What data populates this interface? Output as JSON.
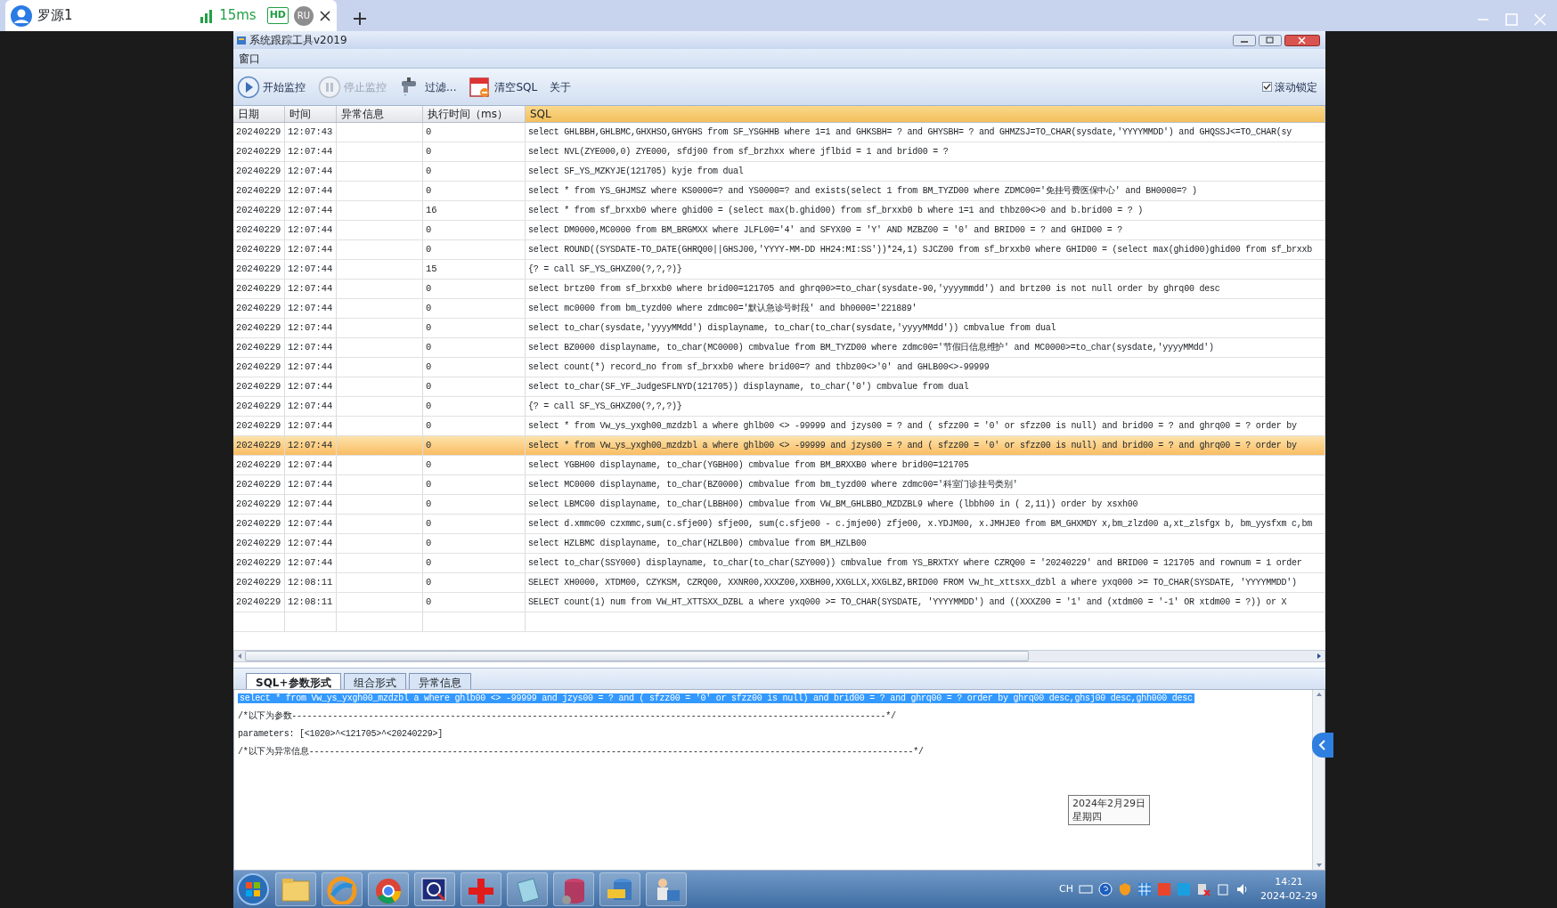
{
  "remote_tab": {
    "title": "罗源1",
    "latency": "15ms",
    "badge": "HD",
    "user_initials": "RU"
  },
  "app": {
    "title": "系统跟踪工具v2019",
    "menu": [
      "窗口"
    ]
  },
  "toolbar": [
    {
      "kind": "play",
      "label": "开始监控",
      "disabled": false
    },
    {
      "kind": "pause",
      "label": "停止监控",
      "disabled": true
    },
    {
      "kind": "filter",
      "label": "过滤...",
      "disabled": false
    },
    {
      "kind": "clear",
      "label": "清空SQL",
      "disabled": false
    },
    {
      "kind": "text",
      "label": "关于",
      "disabled": false
    }
  ],
  "scroll_lock": {
    "label": "滚动锁定",
    "checked": true
  },
  "table": {
    "columns": [
      "日期",
      "时间",
      "异常信息",
      "执行时间（ms）",
      "SQL"
    ],
    "rows": [
      {
        "date": "20240229",
        "time": "12:07:43",
        "error": "",
        "duration": "0",
        "sql": "select GHLBBH,GHLBMC,GHXHSO,GHYGHS from SF_YSGHHB where 1=1 and GHKSBH= ? and GHYSBH= ? and GHMZSJ=TO_CHAR(sysdate,'YYYYMMDD') and GHQSSJ<=TO_CHAR(sy",
        "selected": false
      },
      {
        "date": "20240229",
        "time": "12:07:44",
        "error": "",
        "duration": "0",
        "sql": "select NVL(ZYE000,0) ZYE000, sfdj00 from sf_brzhxx where jflbid = 1 and brid00 = ?",
        "selected": false
      },
      {
        "date": "20240229",
        "time": "12:07:44",
        "error": "",
        "duration": "0",
        "sql": "select SF_YS_MZKYJE(121705) kyje from dual",
        "selected": false
      },
      {
        "date": "20240229",
        "time": "12:07:44",
        "error": "",
        "duration": "0",
        "sql": "select * from YS_GHJMSZ where KS0000=? and YS0000=? and exists(select 1 from BM_TYZD00 where ZDMC00='免挂号费医保中心' and BH0000=? )",
        "selected": false
      },
      {
        "date": "20240229",
        "time": "12:07:44",
        "error": "",
        "duration": "16",
        "sql": "select * from sf_brxxb0 where ghid00 = (select max(b.ghid00) from sf_brxxb0 b where 1=1 and thbz00<>0 and b.brid00 = ? )",
        "selected": false
      },
      {
        "date": "20240229",
        "time": "12:07:44",
        "error": "",
        "duration": "0",
        "sql": "select DM0000,MC0000 from BM_BRGMXX where JLFL00='4' and SFYX00 = 'Y' AND MZBZ00 = '0' and BRID00 = ? and GHID00 = ?",
        "selected": false
      },
      {
        "date": "20240229",
        "time": "12:07:44",
        "error": "",
        "duration": "0",
        "sql": "select ROUND((SYSDATE-TO_DATE(GHRQ00||GHSJ00,'YYYY-MM-DD HH24:MI:SS'))*24,1) SJCZ00 from sf_brxxb0 where GHID00 = (select max(ghid00)ghid00 from sf_brxxb",
        "selected": false
      },
      {
        "date": "20240229",
        "time": "12:07:44",
        "error": "",
        "duration": "15",
        "sql": "{? = call SF_YS_GHXZ00(?,?,?)}",
        "selected": false
      },
      {
        "date": "20240229",
        "time": "12:07:44",
        "error": "",
        "duration": "0",
        "sql": "select brtz00 from sf_brxxb0 where brid00=121705 and ghrq00>=to_char(sysdate-90,'yyyymmdd') and brtz00 is not null order by ghrq00 desc",
        "selected": false
      },
      {
        "date": "20240229",
        "time": "12:07:44",
        "error": "",
        "duration": "0",
        "sql": "select mc0000 from bm_tyzd00 where zdmc00='默认急诊号时段' and bh0000='221889'",
        "selected": false
      },
      {
        "date": "20240229",
        "time": "12:07:44",
        "error": "",
        "duration": "0",
        "sql": "select to_char(sysdate,'yyyyMMdd') displayname, to_char(to_char(sysdate,'yyyyMMdd')) cmbvalue from dual",
        "selected": false
      },
      {
        "date": "20240229",
        "time": "12:07:44",
        "error": "",
        "duration": "0",
        "sql": "select BZ0000 displayname, to_char(MC0000) cmbvalue from BM_TYZD00 where zdmc00='节假日信息维护' and MC0000>=to_char(sysdate,'yyyyMMdd')",
        "selected": false
      },
      {
        "date": "20240229",
        "time": "12:07:44",
        "error": "",
        "duration": "0",
        "sql": "select count(*) record_no from sf_brxxb0 where brid00=? and thbz00<>'0' and GHLB00<>-99999",
        "selected": false
      },
      {
        "date": "20240229",
        "time": "12:07:44",
        "error": "",
        "duration": "0",
        "sql": "select to_char(SF_YF_JudgeSFLNYD(121705)) displayname, to_char('0') cmbvalue from dual",
        "selected": false
      },
      {
        "date": "20240229",
        "time": "12:07:44",
        "error": "",
        "duration": "0",
        "sql": "{? = call SF_YS_GHXZ00(?,?,?)}",
        "selected": false
      },
      {
        "date": "20240229",
        "time": "12:07:44",
        "error": "",
        "duration": "0",
        "sql": "select * from Vw_ys_yxgh00_mzdzbl a where ghlb00 <> -99999 and jzys00 = ? and ( sfzz00 = '0' or sfzz00 is null) and brid00 = ? and ghrq00 = ? order by",
        "selected": false
      },
      {
        "date": "20240229",
        "time": "12:07:44",
        "error": "",
        "duration": "0",
        "sql": "select * from Vw_ys_yxgh00_mzdzbl a where ghlb00 <> -99999 and jzys00 = ? and ( sfzz00 = '0' or sfzz00 is null) and brid00 = ? and ghrq00 = ? order by",
        "selected": true
      },
      {
        "date": "20240229",
        "time": "12:07:44",
        "error": "",
        "duration": "0",
        "sql": "select YGBH00 displayname, to_char(YGBH00) cmbvalue from BM_BRXXB0 where brid00=121705",
        "selected": false
      },
      {
        "date": "20240229",
        "time": "12:07:44",
        "error": "",
        "duration": "0",
        "sql": "select MC0000 displayname, to_char(BZ0000) cmbvalue from bm_tyzd00 where zdmc00='科室门诊挂号类别'",
        "selected": false
      },
      {
        "date": "20240229",
        "time": "12:07:44",
        "error": "",
        "duration": "0",
        "sql": "select LBMC00 displayname, to_char(LBBH00) cmbvalue from VW_BM_GHLBBO_MZDZBL9 where (lbbh00 in ( 2,11)) order by xsxh00",
        "selected": false
      },
      {
        "date": "20240229",
        "time": "12:07:44",
        "error": "",
        "duration": "0",
        "sql": "select d.xmmc00 czxmmc,sum(c.sfje00) sfje00, sum(c.sfje00 - c.jmje00) zfje00, x.YDJM00, x.JMHJE0 from BM_GHXMDY x,bm_zlzd00 a,xt_zlsfgx b, bm_yysfxm c,bm",
        "selected": false
      },
      {
        "date": "20240229",
        "time": "12:07:44",
        "error": "",
        "duration": "0",
        "sql": "select HZLBMC displayname, to_char(HZLB00) cmbvalue from BM_HZLB00",
        "selected": false
      },
      {
        "date": "20240229",
        "time": "12:07:44",
        "error": "",
        "duration": "0",
        "sql": "select to_char(SSY000) displayname, to_char(to_char(SZY000)) cmbvalue from YS_BRXTXY where CZRQ00 = '20240229' and BRID00 = 121705 and rownum = 1 order",
        "selected": false
      },
      {
        "date": "20240229",
        "time": "12:08:11",
        "error": "",
        "duration": "0",
        "sql": "SELECT XH0000, XTDM00, CZYKSM, CZRQ00, XXNR00,XXXZ00,XXBH00,XXGLLX,XXGLBZ,BRID00 FROM Vw_ht_xttsxx_dzbl a where yxq000 >= TO_CHAR(SYSDATE, 'YYYYMMDD')",
        "selected": false
      },
      {
        "date": "20240229",
        "time": "12:08:11",
        "error": "",
        "duration": "0",
        "sql": "SELECT count(1) num from VW_HT_XTTSXX_DZBL a where yxq000 >= TO_CHAR(SYSDATE, 'YYYYMMDD') and ((XXXZ00 = '1' and (xtdm00 = '-1' OR xtdm00 = ?)) or X",
        "selected": false
      }
    ]
  },
  "detail_tabs": [
    {
      "label": "SQL+参数形式",
      "selected": true
    },
    {
      "label": "组合形式",
      "selected": false
    },
    {
      "label": "异常信息",
      "selected": false
    }
  ],
  "detail_lines": [
    {
      "text": "select * from Vw_ys_yxgh00_mzdzbl a where ghlb00 <> -99999 and jzys00 = ? and ( sfzz00 = '0' or sfzz00 is null) and brid00 = ? and ghrq00 = ? order by ghrq00 desc,ghsj00 desc,ghh000 desc",
      "selected": true
    },
    {
      "text": "/*以下为参数--------------------------------------------------------------------------------------------------------------------*/",
      "selected": false
    },
    {
      "text": "parameters: [<1020>^<121705>^<20240229>]",
      "selected": false
    },
    {
      "text": "/*以下为异常信息----------------------------------------------------------------------------------------------------------------------*/",
      "selected": false
    }
  ],
  "tooltip": {
    "date": "2024年2月29日",
    "weekday": "星期四"
  },
  "tray": {
    "language": "CH",
    "time": "14:21",
    "date": "2024-02-29"
  }
}
